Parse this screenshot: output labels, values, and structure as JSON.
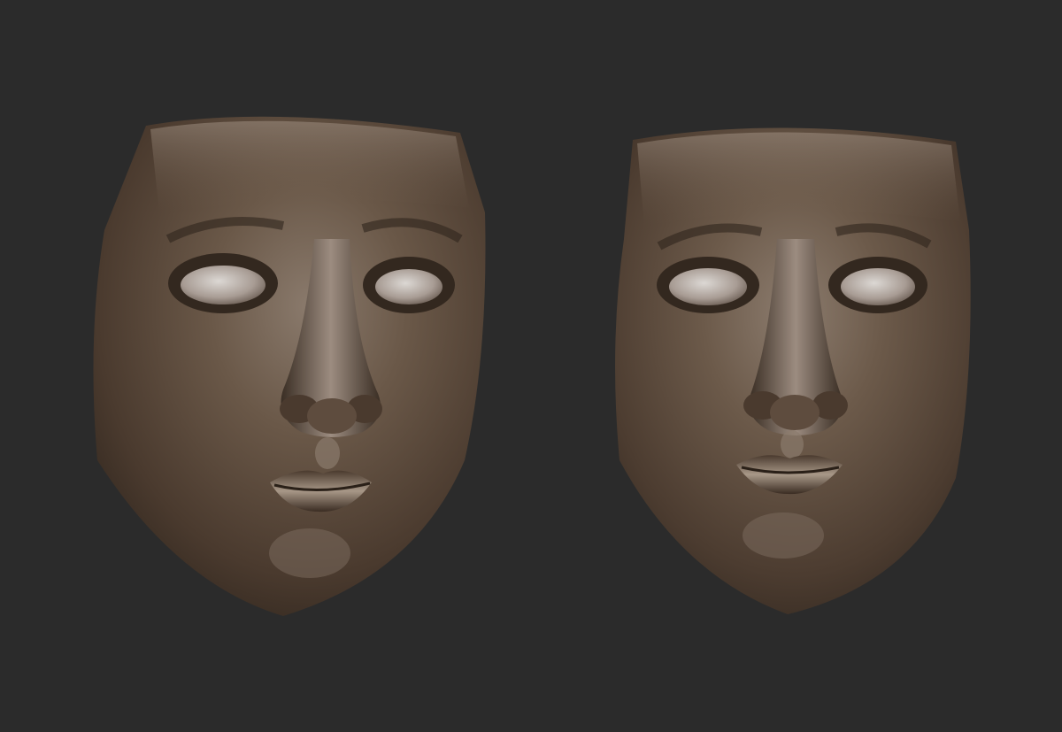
{
  "scene": {
    "background_color": "#2b2b2b",
    "material_colors": {
      "bronze_base": "#5a4a3c",
      "bronze_dark": "#2e241c",
      "bronze_highlight": "#b8a898",
      "specular": "#d8d4d0"
    },
    "objects": [
      {
        "label": "sculpted-face-mask",
        "variant": "left"
      },
      {
        "label": "sculpted-face-mask",
        "variant": "right"
      }
    ]
  }
}
